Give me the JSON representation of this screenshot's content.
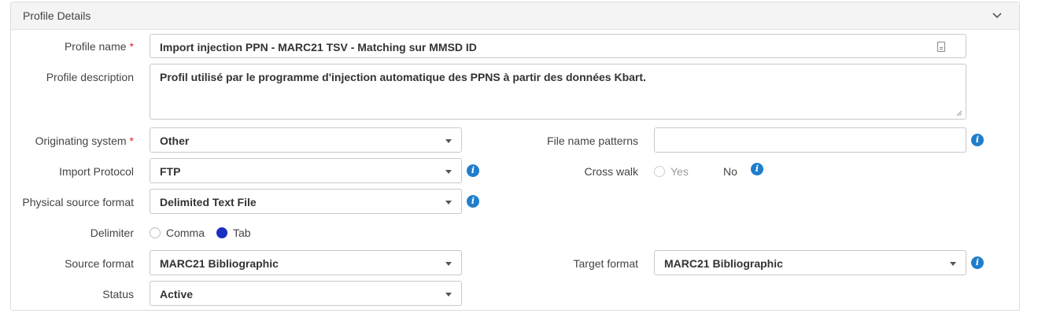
{
  "panel": {
    "title": "Profile Details"
  },
  "fields": {
    "profile_name": {
      "label": "Profile name",
      "required": "*",
      "value": "Import injection PPN - MARC21 TSV - Matching sur MMSD ID"
    },
    "profile_description": {
      "label": "Profile description",
      "value": "Profil utilisé par le programme d'injection automatique des PPNS à partir des données Kbart."
    },
    "originating_system": {
      "label": "Originating system",
      "required": "*",
      "value": "Other"
    },
    "import_protocol": {
      "label": "Import Protocol",
      "value": "FTP"
    },
    "physical_source_format": {
      "label": "Physical source format",
      "value": "Delimited Text File"
    },
    "delimiter": {
      "label": "Delimiter",
      "options": [
        "Comma",
        "Tab"
      ],
      "selected": "Tab"
    },
    "source_format": {
      "label": "Source format",
      "value": "MARC21 Bibliographic"
    },
    "status": {
      "label": "Status",
      "value": "Active"
    },
    "file_name_patterns": {
      "label": "File name patterns",
      "value": ""
    },
    "cross_walk": {
      "label": "Cross walk",
      "options": [
        "Yes",
        "No"
      ],
      "selected": "No"
    },
    "target_format": {
      "label": "Target format",
      "value": "MARC21 Bibliographic"
    }
  },
  "colors": {
    "accent": "#1f7ecb",
    "required": "#d9262c",
    "radio_selected": "#1a2fbf"
  },
  "icons": {
    "collapse": "chevron-down-icon",
    "info": "info-icon",
    "book": "book-icon"
  }
}
